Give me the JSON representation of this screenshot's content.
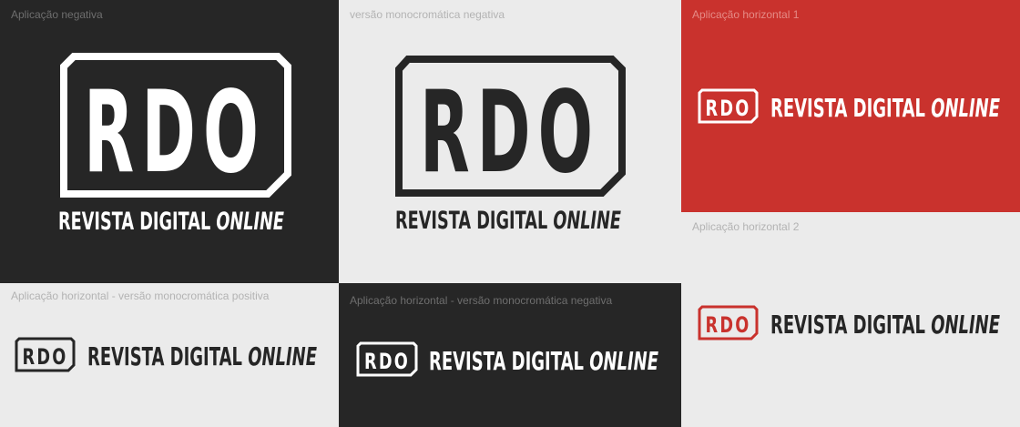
{
  "colors": {
    "dark_bg": "#262626",
    "light_bg": "#ebebeb",
    "red_bg": "#c9322d",
    "white": "#ffffff",
    "dark_ink": "#262626",
    "red_ink": "#c9322d",
    "caption_on_dark": "#6e6e6e",
    "caption_on_light": "#b3b3b3",
    "caption_on_red": "#e58b86"
  },
  "logo": {
    "mark": "RDO",
    "name_regular": "REVISTA DIGITAL",
    "name_italic": "ONLINE"
  },
  "panels": {
    "aplicacao_negativa": {
      "caption": "Aplicação negativa"
    },
    "versao_mono_negativa": {
      "caption": "versão monocromática negativa"
    },
    "horizontal_1": {
      "caption": "Aplicação horizontal 1"
    },
    "horizontal_2": {
      "caption": "Aplicação horizontal 2"
    },
    "horizontal_mono_positiva": {
      "caption": "Aplicação horizontal - versão monocromática positiva"
    },
    "horizontal_mono_negativa": {
      "caption": "Aplicação horizontal - versão monocromática negativa"
    }
  }
}
